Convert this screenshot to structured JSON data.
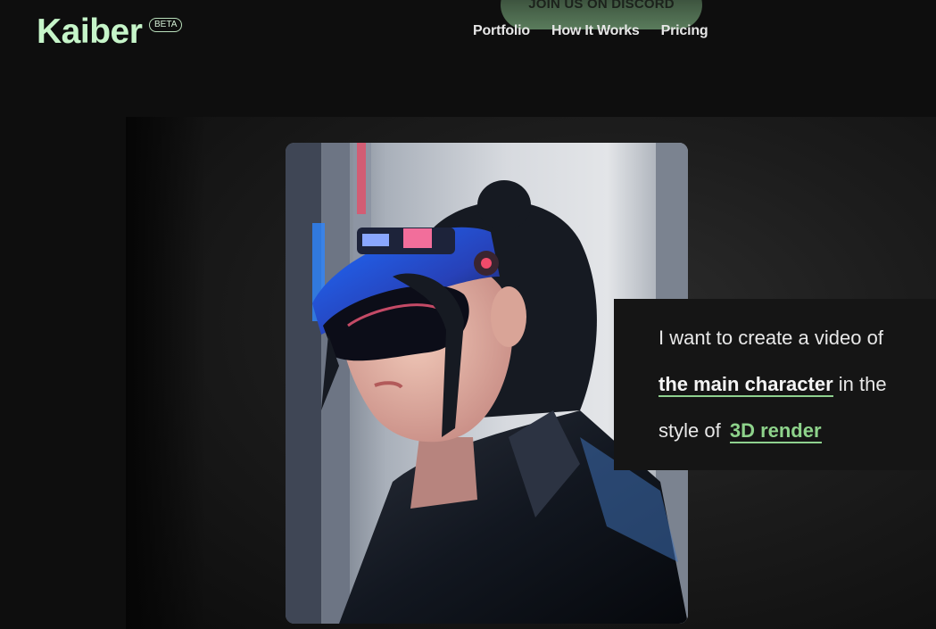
{
  "header": {
    "logo": "Kaiber",
    "badge": "BETA",
    "discord_button": "JOIN US ON DISCORD",
    "nav": [
      {
        "label": "Portfolio"
      },
      {
        "label": "How It Works"
      },
      {
        "label": "Pricing"
      }
    ]
  },
  "hero": {
    "image_subject_icon": "anime-character-artwork",
    "prompt": {
      "prefix": "I want to create a video of",
      "subject": "the main character",
      "middle": "in the",
      "style_prefix": "style of",
      "style": "3D render"
    }
  },
  "colors": {
    "background": "#0e0e0e",
    "logo": "#c6f5c9",
    "accent": "#8ed38b",
    "card": "#151515"
  }
}
